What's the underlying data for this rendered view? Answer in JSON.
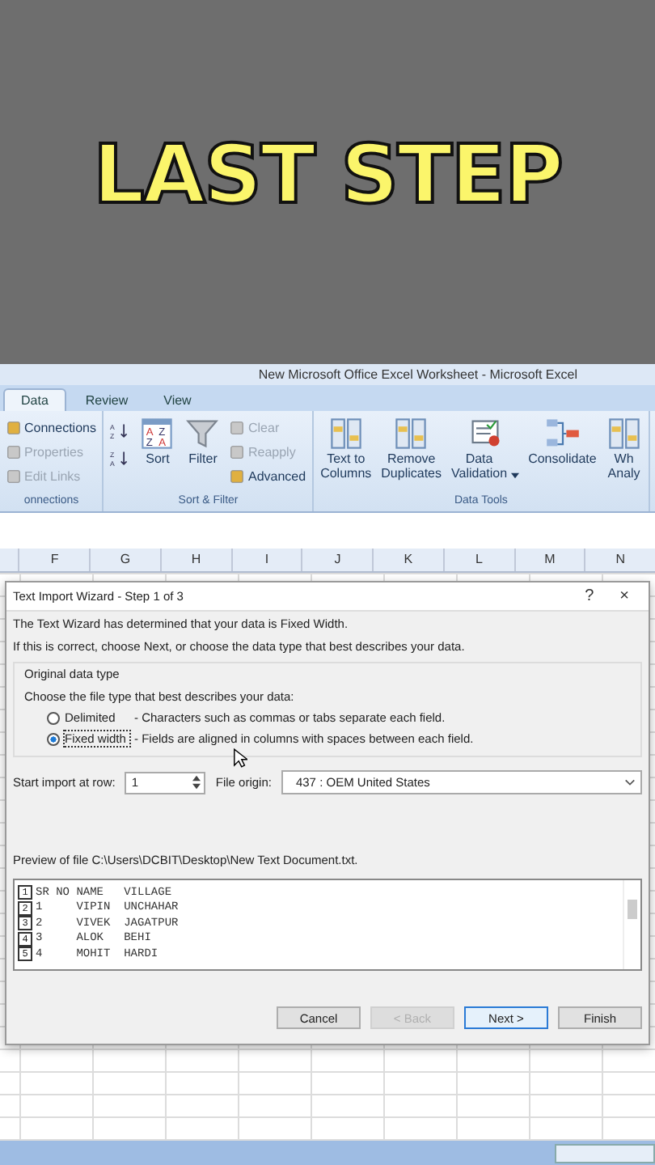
{
  "overlay": {
    "caption": "LAST STEP"
  },
  "excel": {
    "title": "New Microsoft Office Excel Worksheet - Microsoft Excel",
    "tabs": [
      {
        "label": "Data",
        "selected": true
      },
      {
        "label": "Review",
        "selected": false
      },
      {
        "label": "View",
        "selected": false
      }
    ],
    "ribbon_groups": [
      {
        "label": "onnections",
        "items": [
          {
            "kind": "stack",
            "entries": [
              {
                "label": "Connections",
                "disabled": false
              },
              {
                "label": "Properties",
                "disabled": true
              },
              {
                "label": "Edit Links",
                "disabled": true
              }
            ]
          }
        ]
      },
      {
        "label": "Sort & Filter",
        "items": [
          {
            "kind": "sort-arrows",
            "ascending": [
              "A",
              "Z"
            ],
            "descending": [
              "Z",
              "A"
            ]
          },
          {
            "kind": "large",
            "label": "Sort",
            "dropdown": false,
            "icon_letters": [
              "A",
              "Z",
              "Z",
              "A"
            ]
          },
          {
            "kind": "large",
            "label": "Filter",
            "dropdown": false
          },
          {
            "kind": "stack",
            "entries": [
              {
                "label": "Clear",
                "disabled": true
              },
              {
                "label": "Reapply",
                "disabled": true
              },
              {
                "label": "Advanced",
                "disabled": false
              }
            ]
          }
        ]
      },
      {
        "label": "Data Tools",
        "items": [
          {
            "kind": "large",
            "label": "Text to\nColumns",
            "dropdown": false
          },
          {
            "kind": "large",
            "label": "Remove\nDuplicates",
            "dropdown": false
          },
          {
            "kind": "large",
            "label": "Data\nValidation",
            "dropdown": true
          },
          {
            "kind": "large",
            "label": "Consolidate",
            "dropdown": false
          },
          {
            "kind": "large",
            "label": "Wh\nAnaly",
            "dropdown": false
          }
        ]
      }
    ],
    "columns": [
      "F",
      "G",
      "H",
      "I",
      "J",
      "K",
      "L",
      "M",
      "N"
    ]
  },
  "dialog": {
    "title": "Text Import Wizard - Step 1 of 3",
    "help": "?",
    "close": "×",
    "intro": [
      "The Text Wizard has determined that your data is Fixed Width.",
      "If this is correct, choose Next, or choose the data type that best describes your data."
    ],
    "group_label": "Original data type",
    "prompt": "Choose the file type that best describes your data:",
    "options": [
      {
        "label": "Delimited",
        "description": "- Characters such as commas or tabs separate each field.",
        "selected": false
      },
      {
        "label": "Fixed width",
        "description": "- Fields are aligned in columns with spaces between each field.",
        "selected": true
      }
    ],
    "start_row": {
      "label": "Start import at row:",
      "value": "1"
    },
    "file_origin": {
      "label": "File origin:",
      "value": "437 : OEM United States"
    },
    "preview_label": "Preview of file C:\\Users\\DCBIT\\Desktop\\New Text Document.txt.",
    "preview_rows": [
      {
        "number": "1",
        "text": "SR NO NAME   VILLAGE"
      },
      {
        "number": "2",
        "text": "1     VIPIN  UNCHAHAR"
      },
      {
        "number": "3",
        "text": "2     VIVEK  JAGATPUR"
      },
      {
        "number": "4",
        "text": "3     ALOK   BEHI"
      },
      {
        "number": "5",
        "text": "4     MOHIT  HARDI"
      }
    ],
    "buttons": [
      {
        "label": "Cancel",
        "disabled": false,
        "default": false
      },
      {
        "label": "< Back",
        "disabled": true,
        "default": false
      },
      {
        "label": "Next >",
        "disabled": false,
        "default": true
      },
      {
        "label": "Finish",
        "disabled": false,
        "default": false
      }
    ]
  }
}
